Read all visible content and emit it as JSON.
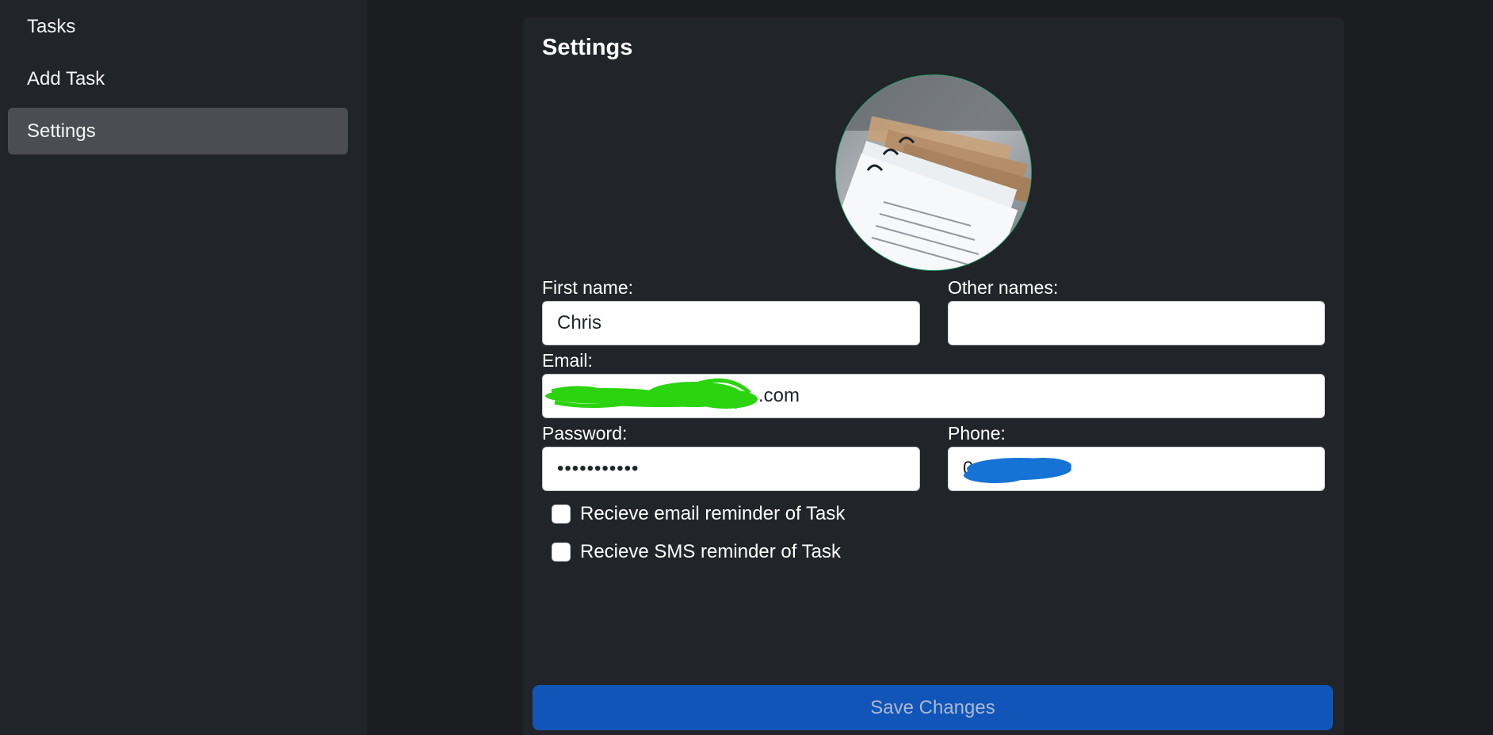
{
  "sidebar": {
    "items": [
      {
        "label": "Tasks"
      },
      {
        "label": "Add Task"
      },
      {
        "label": "Settings",
        "active": true
      }
    ]
  },
  "settings": {
    "title": "Settings",
    "first_name": {
      "label": "First name:",
      "value": "Chris"
    },
    "other_names": {
      "label": "Other names:",
      "value": ""
    },
    "email": {
      "label": "Email:",
      "value": ".com"
    },
    "password": {
      "label": "Password:",
      "value": "•••••••••••"
    },
    "phone": {
      "label": "Phone:",
      "value": "0       0"
    },
    "reminders": [
      {
        "label": "Recieve email reminder of Task",
        "checked": false
      },
      {
        "label": "Recieve SMS reminder of Task",
        "checked": false
      }
    ],
    "save_label": "Save Changes"
  },
  "colors": {
    "background": "#1b1d21",
    "sidebar": "#212429",
    "card": "#212429",
    "active_nav": "#4b4d52",
    "primary_button": "#1255b8",
    "avatar_border": "#1f9d61",
    "email_redaction": "#2bd40f",
    "phone_redaction": "#1673d6"
  },
  "icons": {
    "avatar": "profile-photo-papers",
    "redaction": "scribble-mark"
  }
}
